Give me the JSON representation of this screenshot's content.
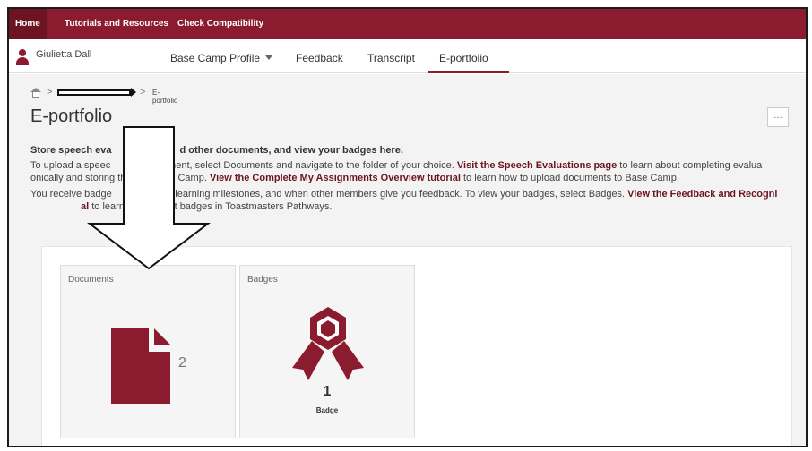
{
  "topbar": {
    "home": "Home",
    "tutorials": "Tutorials and Resources",
    "compatibility": "Check Compatibility"
  },
  "subnav": {
    "user_name": "Giulietta Dall",
    "items": [
      "Base Camp Profile",
      "Feedback",
      "Transcript",
      "E-portfolio"
    ],
    "active": "E-portfolio"
  },
  "breadcrumb": {
    "current": "E-portfolio"
  },
  "page": {
    "title": "E-portfolio",
    "more_label": "…",
    "heading": "Store speech eva",
    "heading_rest": "d other documents, and view your badges here.",
    "para1_a": "To upload a speec",
    "para1_b": " or document, select Documents and navigate to the folder of your choice. ",
    "para1_link1": "Visit the Speech Evaluations page",
    "para1_c": " to learn about completing evalua",
    "para1_d": "onically and storing them in Base Camp. ",
    "para1_link2": "View the Complete My Assignments Overview tutorial",
    "para1_e": " to learn how to upload documents to Base Camp.",
    "para2_a": "You receive badge",
    "para2_b": "reach learning milestones, and when other members give you feedback. To view your badges, select Badges. ",
    "para2_link1": "View the Feedback and Recogni",
    "para2_link2": "al",
    "para2_c": " to learn more about badges in Toastmasters Pathways."
  },
  "tiles": {
    "documents": {
      "label": "Documents",
      "count": "2"
    },
    "badges": {
      "label": "Badges",
      "count": "1",
      "unit": "Badge"
    }
  },
  "colors": {
    "brand": "#8b1b2e",
    "brand_dark": "#6d1422"
  },
  "icons": {
    "home": "home-icon",
    "document": "document-icon",
    "badge": "award-ribbon-icon",
    "annotation": "down-arrow-icon"
  }
}
